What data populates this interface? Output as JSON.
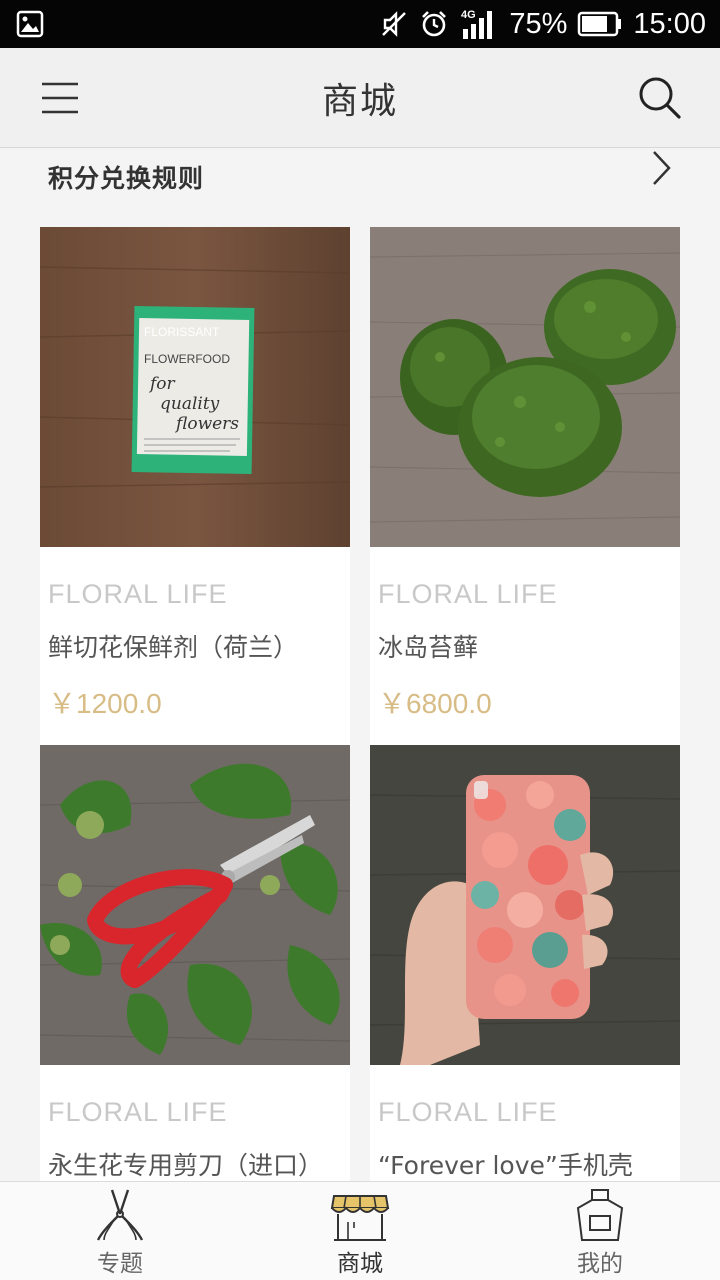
{
  "status_bar": {
    "battery": "75%",
    "time": "15:00",
    "network": "4G"
  },
  "header": {
    "title": "商城",
    "menu_icon": "hamburger-menu-icon",
    "search_icon": "search-icon"
  },
  "rules": {
    "label": "积分兑换规则",
    "chevron_icon": "chevron-right-icon"
  },
  "products": [
    {
      "brand": "FLORAL LIFE",
      "name": "鲜切花保鲜剂（荷兰）",
      "price": "￥1200.0",
      "image": "flower-food-packet",
      "packet_brand": "FLORISSANT",
      "packet_product": "FLOWERFOOD",
      "packet_tagline_1": "for",
      "packet_tagline_2": "quality",
      "packet_tagline_3": "flowers"
    },
    {
      "brand": "FLORAL LIFE",
      "name": "冰岛苔藓",
      "price": "￥6800.0",
      "image": "moss-balls"
    },
    {
      "brand": "FLORAL LIFE",
      "name": "永生花专用剪刀（进口）",
      "price": "",
      "image": "red-scissors"
    },
    {
      "brand": "FLORAL LIFE",
      "name": "“Forever love”手机壳",
      "price": "",
      "image": "floral-phone-case"
    }
  ],
  "tabbar": {
    "tabs": [
      {
        "label": "专题",
        "icon": "pruning-shears-icon",
        "active": false
      },
      {
        "label": "商城",
        "icon": "shop-awning-icon",
        "active": true
      },
      {
        "label": "我的",
        "icon": "apron-icon",
        "active": false
      }
    ]
  },
  "colors": {
    "price": "#d8bc86",
    "brand": "#c8c8c8",
    "awning": "#e6c46a"
  }
}
